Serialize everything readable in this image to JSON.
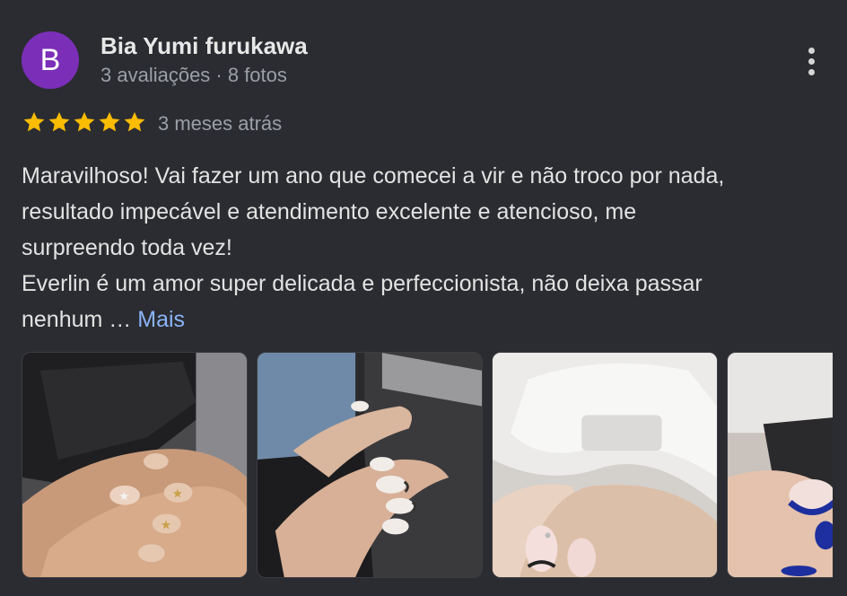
{
  "reviewer": {
    "initial": "B",
    "name": "Bia Yumi furukawa",
    "meta": "3 avaliações · 8 fotos",
    "avatar_color": "#7b2fb8"
  },
  "rating": {
    "stars": 5,
    "max": 5,
    "star_color": "#fbbc04",
    "when": "3 meses atrás"
  },
  "review": {
    "lines": [
      "Maravilhoso! Vai fazer um ano que comecei a vir e não troco por nada,",
      "resultado impecável e atendimento excelente e atencioso, me",
      "surpreendo toda vez!",
      "Everlin é um amor super delicada e perfeccionista, não deixa passar",
      "nenhum … "
    ],
    "more_label": "Mais"
  },
  "menu": {
    "icon": "more-vert-icon"
  },
  "photos": [
    {
      "subject": "nail-photo-1"
    },
    {
      "subject": "nail-photo-2"
    },
    {
      "subject": "nail-photo-3"
    },
    {
      "subject": "nail-photo-4"
    }
  ]
}
